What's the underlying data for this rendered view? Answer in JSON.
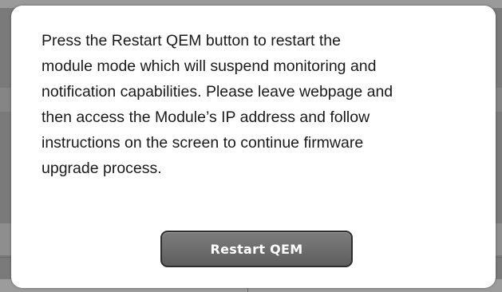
{
  "dialog": {
    "message_lines": [
      "Press the Restart QEM button to restart the",
      "module mode which will suspend monitoring and",
      "notification capabilities. Please leave webpage and",
      "then access the Module’s IP address and follow",
      "instructions on the screen to continue firmware",
      "upgrade process."
    ],
    "restart_button_label": "Restart QEM"
  },
  "colors": {
    "overlay": "#7a7a7a",
    "dialog_background": "#ffffff",
    "button_background": "#6b6b6b",
    "button_border": "#2e2e2e",
    "button_text": "#ffffff"
  }
}
